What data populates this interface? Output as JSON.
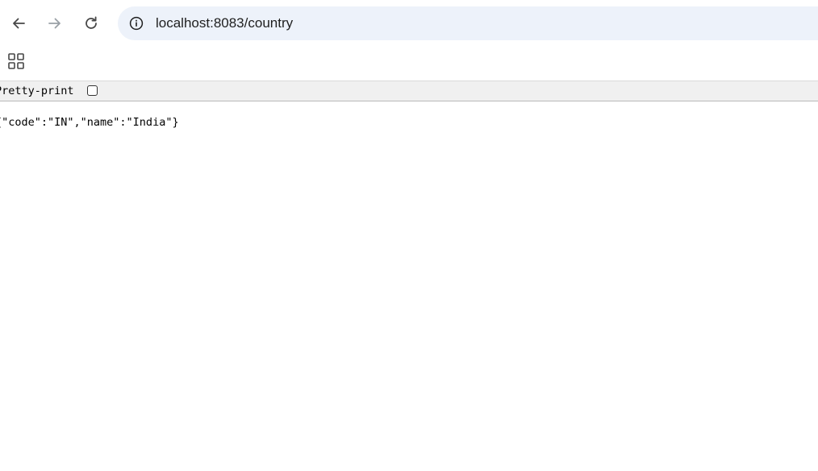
{
  "browser": {
    "back_icon": "arrow-left-icon",
    "forward_icon": "arrow-right-icon",
    "reload_icon": "reload-icon",
    "site_info_icon": "info-circle-icon",
    "apps_icon": "apps-grid-icon",
    "url": "localhost:8083/country"
  },
  "json_viewer": {
    "pretty_print_label": "Pretty-print",
    "pretty_print_checked": false,
    "content": "{\"code\":\"IN\",\"name\":\"India\"}"
  },
  "colors": {
    "omnibox_bg": "#edf2fa",
    "toolbar_bar_bg": "#f0f0f0",
    "forward_disabled": "#9aa0a6"
  }
}
